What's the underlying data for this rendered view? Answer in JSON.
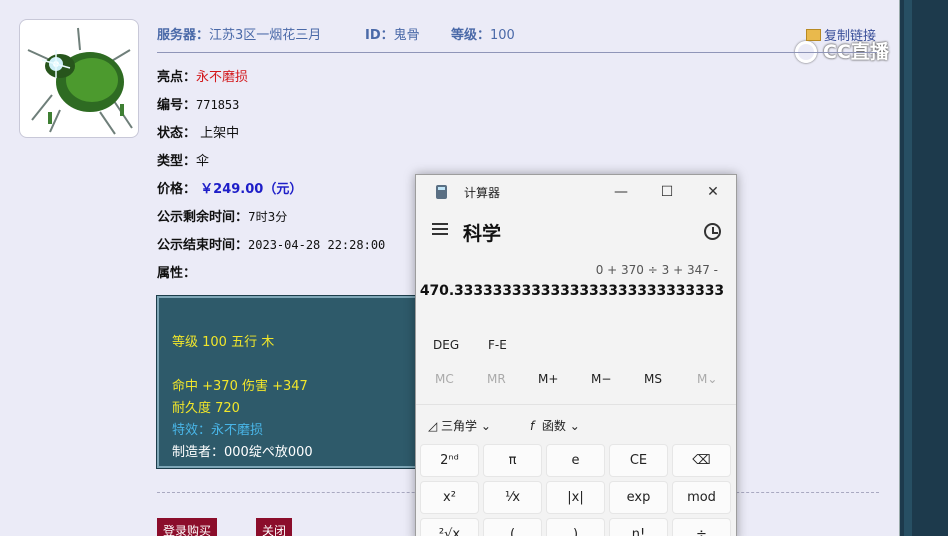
{
  "header": {
    "server_label": "服务器：",
    "server_value": "江苏3区一烟花三月",
    "id_label": "ID：",
    "id_value": "鬼骨",
    "level_label": "等级：",
    "level_value": "100",
    "copy_link": "复制链接"
  },
  "watermark": "CC直播",
  "details": {
    "highlight_label": "亮点：",
    "highlight_value": "永不磨损",
    "number_label": "编号：",
    "number_value": "771853",
    "status_label": "状态：",
    "status_value": "上架中",
    "type_label": "类型：",
    "type_value": "伞",
    "price_label": "价格：",
    "price_value": "￥249.00（元）",
    "remaining_label": "公示剩余时间：",
    "remaining_value": "7时3分",
    "end_label": "公示结束时间：",
    "end_value": "2023-04-28 22:28:00",
    "attr_label": "属性："
  },
  "attributes": {
    "line1": "等级 100 五行 木",
    "line2": "命中 +370 伤害 +347",
    "line3": "耐久度 720",
    "line4": "特效：永不磨损",
    "line5": "制造者：000绽ぺ放000"
  },
  "buttons": {
    "buy": "登录购买",
    "close": "关闭"
  },
  "calculator": {
    "title": "计算器",
    "mode": "科学",
    "expression": "0 + 370 ÷ 3 + 347 -",
    "result": "470.3333333333333333333333333333",
    "deg": "DEG",
    "fe": "F-E",
    "memory": [
      "MC",
      "MR",
      "M+",
      "M−",
      "MS",
      "M⌄"
    ],
    "trig_label": "三角学",
    "func_label": "函数",
    "keys_row1": [
      "2ⁿᵈ",
      "π",
      "e",
      "CE",
      "⌫"
    ],
    "keys_row2": [
      "x²",
      "¹⁄x",
      "|x|",
      "exp",
      "mod"
    ],
    "keys_row3": [
      "²√x",
      "(",
      ")",
      "n!",
      "÷"
    ]
  }
}
